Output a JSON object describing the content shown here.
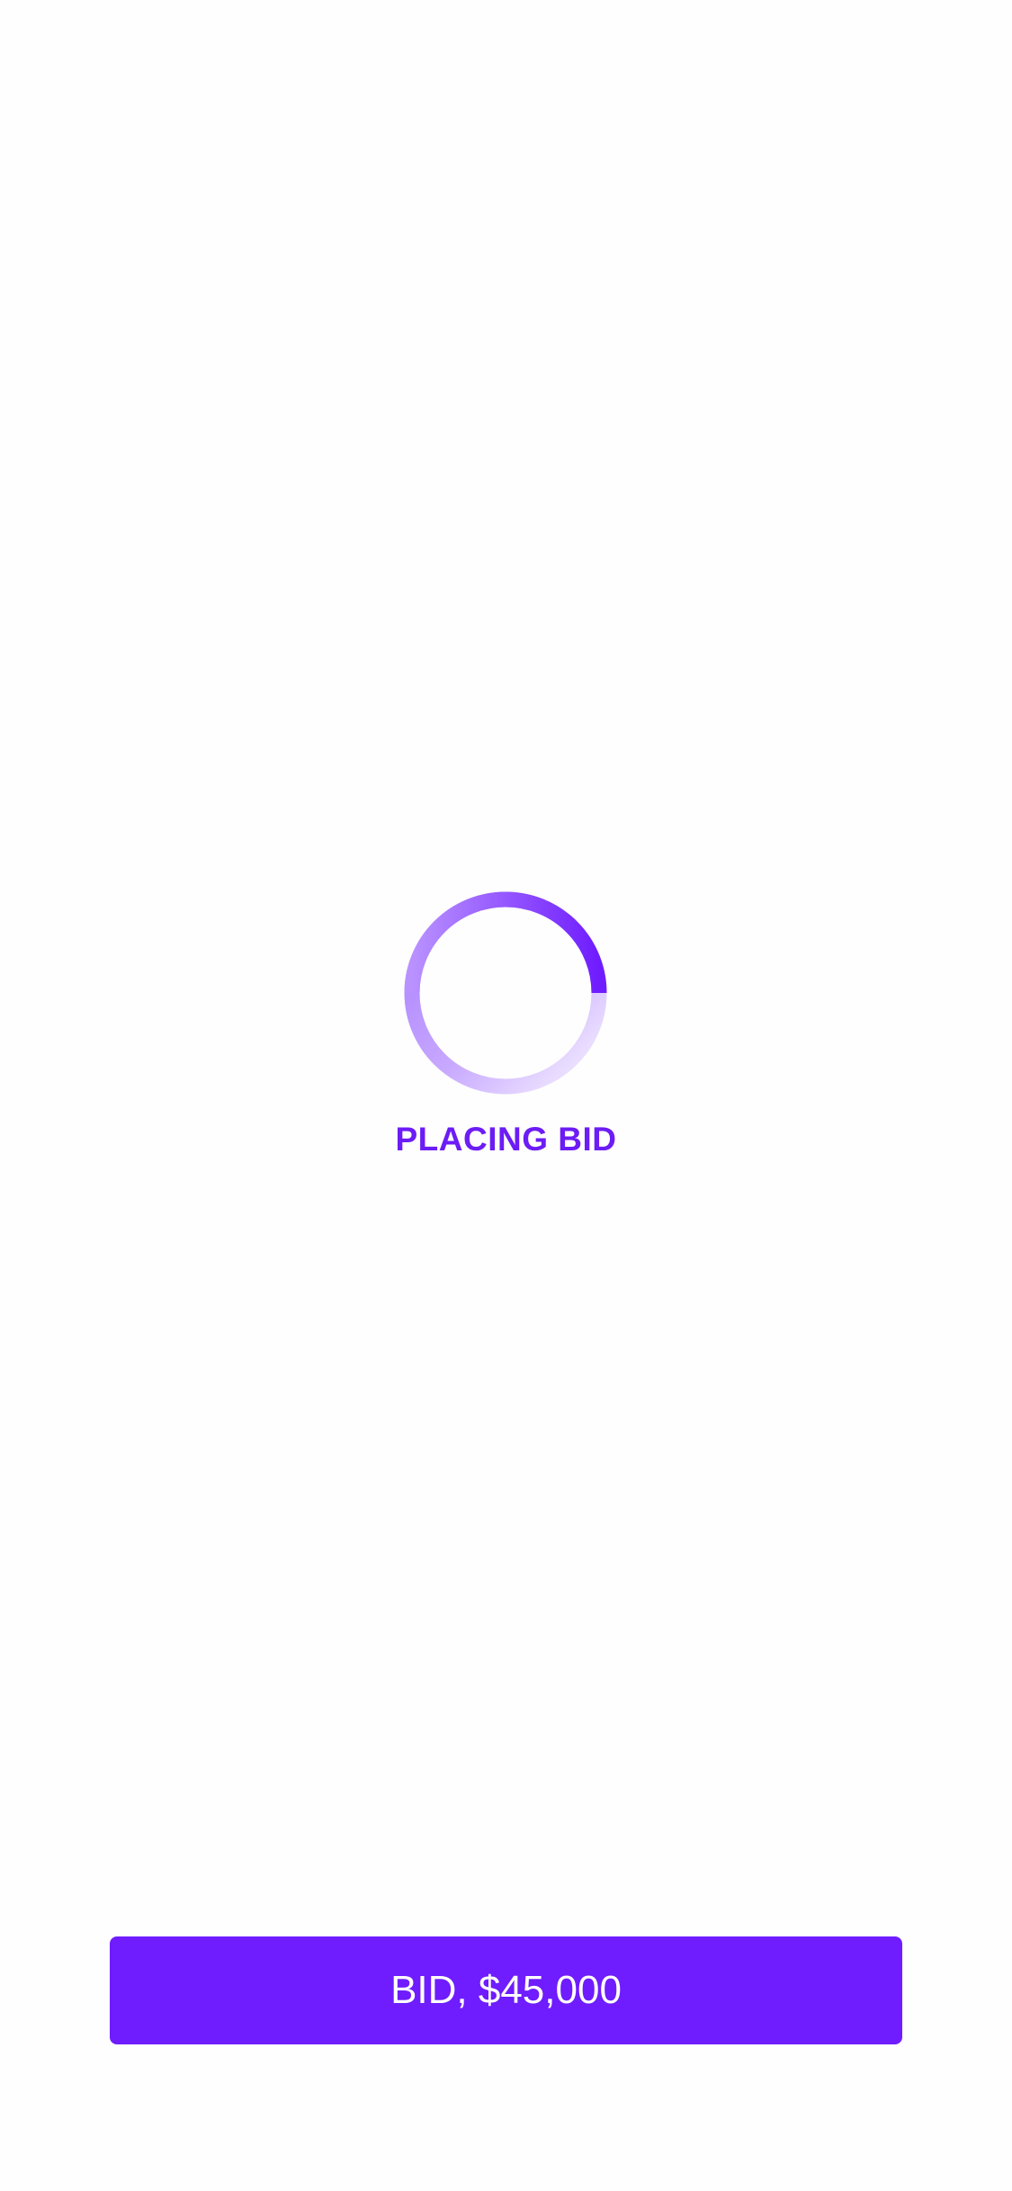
{
  "loading": {
    "text": "PLACING BID",
    "spinner_icon": "spinner-icon"
  },
  "bid_button": {
    "label": "BID, $45,000"
  },
  "colors": {
    "background": "#fefefe",
    "accent": "#6c1cf5",
    "button_background": "#6f1cff",
    "button_text": "#ffffff",
    "spinner_light": "#efe7ff"
  }
}
